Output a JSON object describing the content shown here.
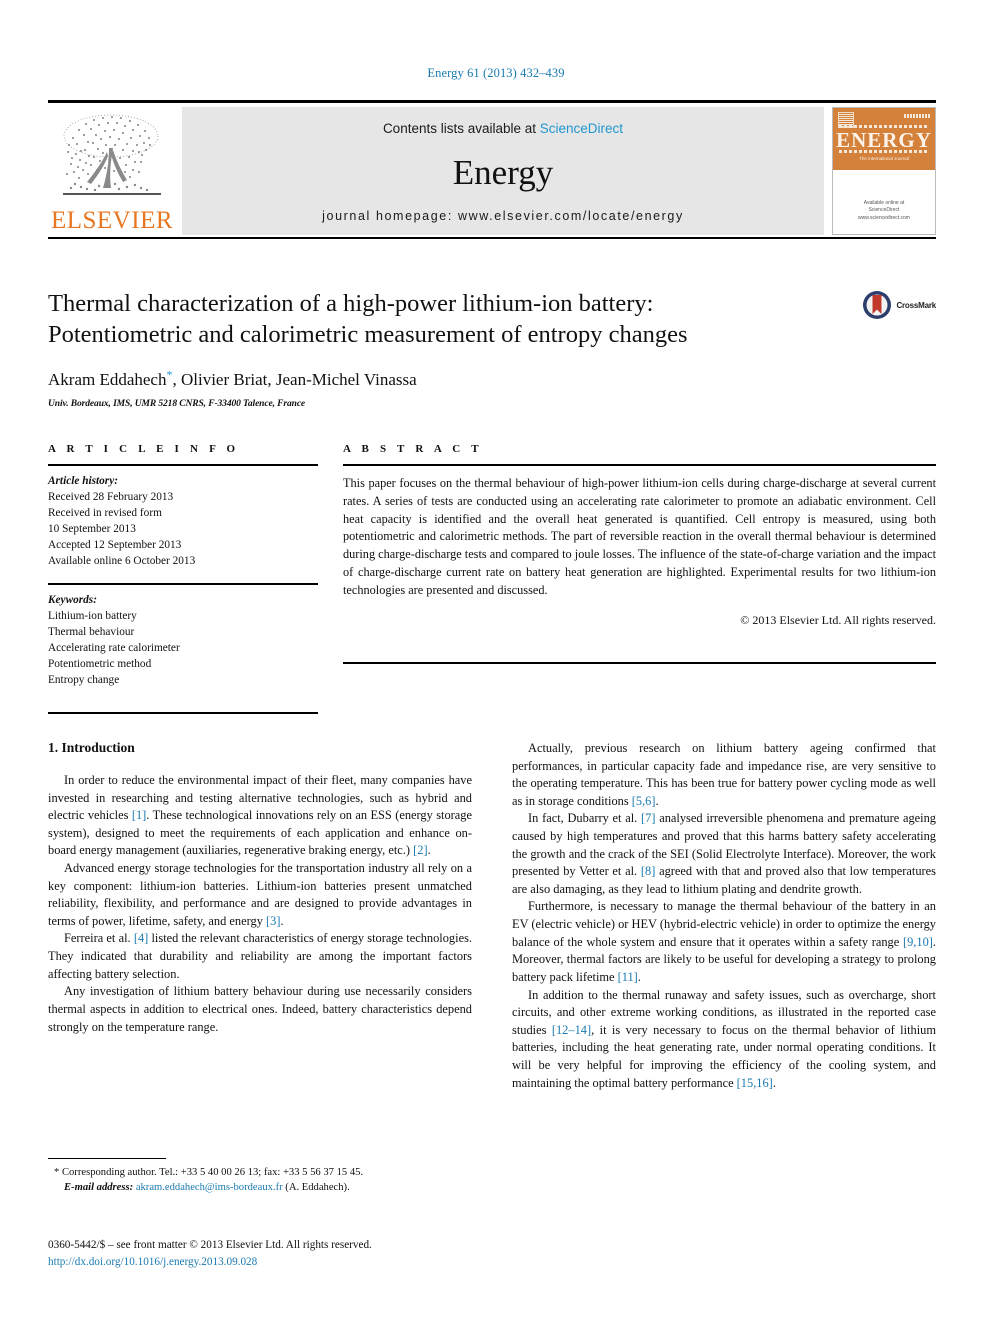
{
  "running_head": "Energy 61 (2013) 432–439",
  "masthead": {
    "contents_prefix": "Contents lists available at ",
    "contents_link": "ScienceDirect",
    "journal_name": "Energy",
    "homepage": "journal homepage: www.elsevier.com/locate/energy",
    "publisher_logo_text": "ELSEVIER",
    "cover": {
      "title": "ENERGY",
      "subtitle": "The International Journal",
      "footer": "Available online at\nScienceDirect\nwww.sciencedirect.com"
    }
  },
  "article": {
    "title": "Thermal characterization of a high-power lithium-ion battery: Potentiometric and calorimetric measurement of entropy changes",
    "authors": "Akram Eddahech, Olivier Briat, Jean-Michel Vinassa",
    "author_marker": "*",
    "affiliation": "Univ. Bordeaux, IMS, UMR 5218 CNRS, F-33400 Talence, France",
    "crossmark_label": "CrossMark"
  },
  "article_info": {
    "heading": "A R T I C L E   I N F O",
    "history_label": "Article history:",
    "history": [
      "Received 28 February 2013",
      "Received in revised form",
      "10 September 2013",
      "Accepted 12 September 2013",
      "Available online 6 October 2013"
    ],
    "keywords_label": "Keywords:",
    "keywords": [
      "Lithium-ion battery",
      "Thermal behaviour",
      "Accelerating rate calorimeter",
      "Potentiometric method",
      "Entropy change"
    ]
  },
  "abstract": {
    "heading": "A B S T R A C T",
    "text": "This paper focuses on the thermal behaviour of high-power lithium-ion cells during charge-discharge at several current rates. A series of tests are conducted using an accelerating rate calorimeter to promote an adiabatic environment. Cell heat capacity is identified and the overall heat generated is quantified. Cell entropy is measured, using both potentiometric and calorimetric methods. The part of reversible reaction in the overall thermal behaviour is determined during charge-discharge tests and compared to joule losses. The influence of the state-of-charge variation and the impact of charge-discharge current rate on battery heat generation are highlighted. Experimental results for two lithium-ion technologies are presented and discussed.",
    "copyright": "© 2013 Elsevier Ltd. All rights reserved."
  },
  "body": {
    "section_number_title": "1.  Introduction",
    "left_paragraphs": [
      "In order to reduce the environmental impact of their fleet, many companies have invested in researching and testing alternative technologies, such as hybrid and electric vehicles [1]. These technological innovations rely on an ESS (energy storage system), designed to meet the requirements of each application and enhance on-board energy management (auxiliaries, regenerative braking energy, etc.) [2].",
      "Advanced energy storage technologies for the transportation industry all rely on a key component: lithium-ion batteries. Lithium-ion batteries present unmatched reliability, flexibility, and performance and are designed to provide advantages in terms of power, lifetime, safety, and energy [3].",
      "Ferreira et al. [4] listed the relevant characteristics of energy storage technologies. They indicated that durability and reliability are among the important factors affecting battery selection.",
      "Any investigation of lithium battery behaviour during use necessarily considers thermal aspects in addition to electrical ones. Indeed, battery characteristics depend strongly on the temperature range."
    ],
    "right_paragraphs": [
      "Actually, previous research on lithium battery ageing confirmed that performances, in particular capacity fade and impedance rise, are very sensitive to the operating temperature. This has been true for battery power cycling mode as well as in storage conditions [5,6].",
      "In fact, Dubarry et al. [7] analysed irreversible phenomena and premature ageing caused by high temperatures and proved that this harms battery safety accelerating the growth and the crack of the SEI (Solid Electrolyte Interface). Moreover, the work presented by Vetter et al. [8] agreed with that and proved also that low temperatures are also damaging, as they lead to lithium plating and dendrite growth.",
      "Furthermore, is necessary to manage the thermal behaviour of the battery in an EV (electric vehicle) or HEV (hybrid-electric vehicle) in order to optimize the energy balance of the whole system and ensure that it operates within a safety range [9,10]. Moreover, thermal factors are likely to be useful for developing a strategy to prolong battery pack lifetime [11].",
      "In addition to the thermal runaway and safety issues, such as overcharge, short circuits, and other extreme working conditions, as illustrated in the reported case studies [12–14], it is very necessary to focus on the thermal behavior of lithium batteries, including the heat generating rate, under normal operating conditions. It will be very helpful for improving the efficiency of the cooling system, and maintaining the optimal battery performance [15,16]."
    ]
  },
  "footnote": {
    "corresponding": "* Corresponding author. Tel.: +33 5 40 00 26 13; fax: +33 5 56 37 15 45.",
    "email_label": "E-mail address:",
    "email": "akram.eddahech@ims-bordeaux.fr",
    "email_suffix": "(A. Eddahech)."
  },
  "imprint": {
    "line": "0360-5442/$ – see front matter © 2013 Elsevier Ltd. All rights reserved.",
    "doi": "http://dx.doi.org/10.1016/j.energy.2013.09.028"
  },
  "colors": {
    "link_blue": "#1a7ab0",
    "sciencedirect_blue": "#2196d1",
    "elsevier_orange": "#E87722",
    "cover_orange": "#d4813c",
    "crossmark_red": "#c0392b",
    "crossmark_navy": "#2c3e6b"
  }
}
